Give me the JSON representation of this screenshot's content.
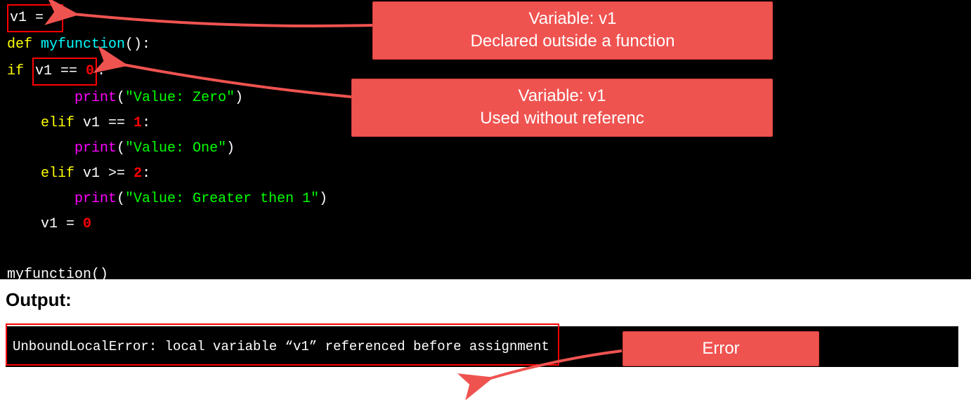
{
  "code": {
    "line1_var": "v1",
    "line1_eq": " = ",
    "line1_val": "1",
    "line2_def": "def ",
    "line2_name": "myfunction",
    "line2_paren": "():",
    "line3_if": "if ",
    "line3_cond_var": "v1",
    "line3_cond_op": " == ",
    "line3_cond_val": "0",
    "line3_colon": ":",
    "line4_indent": "        ",
    "line4_print": "print",
    "line4_open": "(",
    "line4_str": "\"Value: Zero\"",
    "line4_close": ")",
    "line5_indent": "    ",
    "line5_elif": "elif ",
    "line5_var": "v1",
    "line5_op": " == ",
    "line5_val": "1",
    "line5_colon": ":",
    "line6_indent": "        ",
    "line6_print": "print",
    "line6_open": "(",
    "line6_str": "\"Value: One\"",
    "line6_close": ")",
    "line7_indent": "    ",
    "line7_elif": "elif ",
    "line7_var": "v1",
    "line7_op": " >= ",
    "line7_val": "2",
    "line7_colon": ":",
    "line8_indent": "        ",
    "line8_print": "print",
    "line8_open": "(",
    "line8_str": "\"Value: Greater then 1\"",
    "line8_close": ")",
    "line9_indent": "    ",
    "line9_var": "v1",
    "line9_eq": " = ",
    "line9_val": "0",
    "line10_blank": " ",
    "line11_call": "myfunction()"
  },
  "callouts": {
    "c1_l1": "Variable: v1",
    "c1_l2": "Declared outside a function",
    "c2_l1": "Variable: v1",
    "c2_l2": "Used without referenc",
    "c3": "Error"
  },
  "output": {
    "heading": "Output:",
    "text": "UnboundLocalError: local variable “v1” referenced before assignment"
  }
}
